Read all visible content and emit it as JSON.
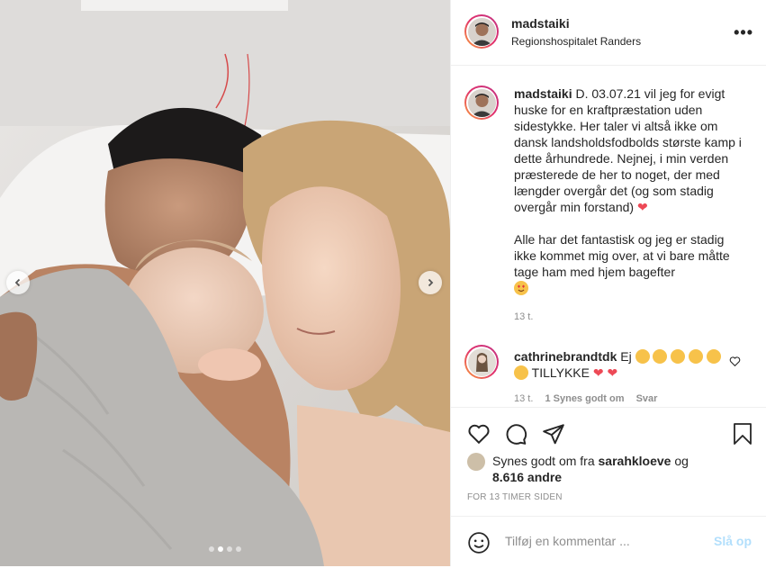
{
  "post": {
    "username": "madstaiki",
    "location": "Regionshospitalet Randers",
    "more_icon": "more-options-icon"
  },
  "caption": {
    "username": "madstaiki",
    "text_1": "D. 03.07.21 vil jeg for evigt huske for en kraftpræstation uden sidestykke. Her taler vi altså ikke om dansk landsholdsfodbolds største kamp i dette århundrede. Nejnej, i min verden præsterede de her to noget, der med længder overgår det (og som stadig overgår min forstand)",
    "text_2": "Alle har det fantastisk og jeg er stadig ikke kommet mig over, at vi bare måtte tage ham med hjem bagefter",
    "time": "13 t."
  },
  "comment": {
    "username": "cathrinebrandtdk",
    "text_1": "Ej",
    "text_2": "TILLYKKE",
    "time": "13 t.",
    "likes": "1 Synes godt om",
    "reply": "Svar"
  },
  "likes": {
    "prefix": "Synes godt om fra",
    "user": "sarahkloeve",
    "and": "og",
    "others": "8.616 andre"
  },
  "timestamp": "FOR 13 TIMER SIDEN",
  "add_comment": {
    "placeholder": "Tilføj en kommentar ...",
    "post_label": "Slå op"
  },
  "carousel": {
    "count": 4,
    "active_index": 1
  },
  "colors": {
    "accent_disabled": "#b2dffc",
    "heart": "#ed4956",
    "muted": "#8e8e8e"
  }
}
